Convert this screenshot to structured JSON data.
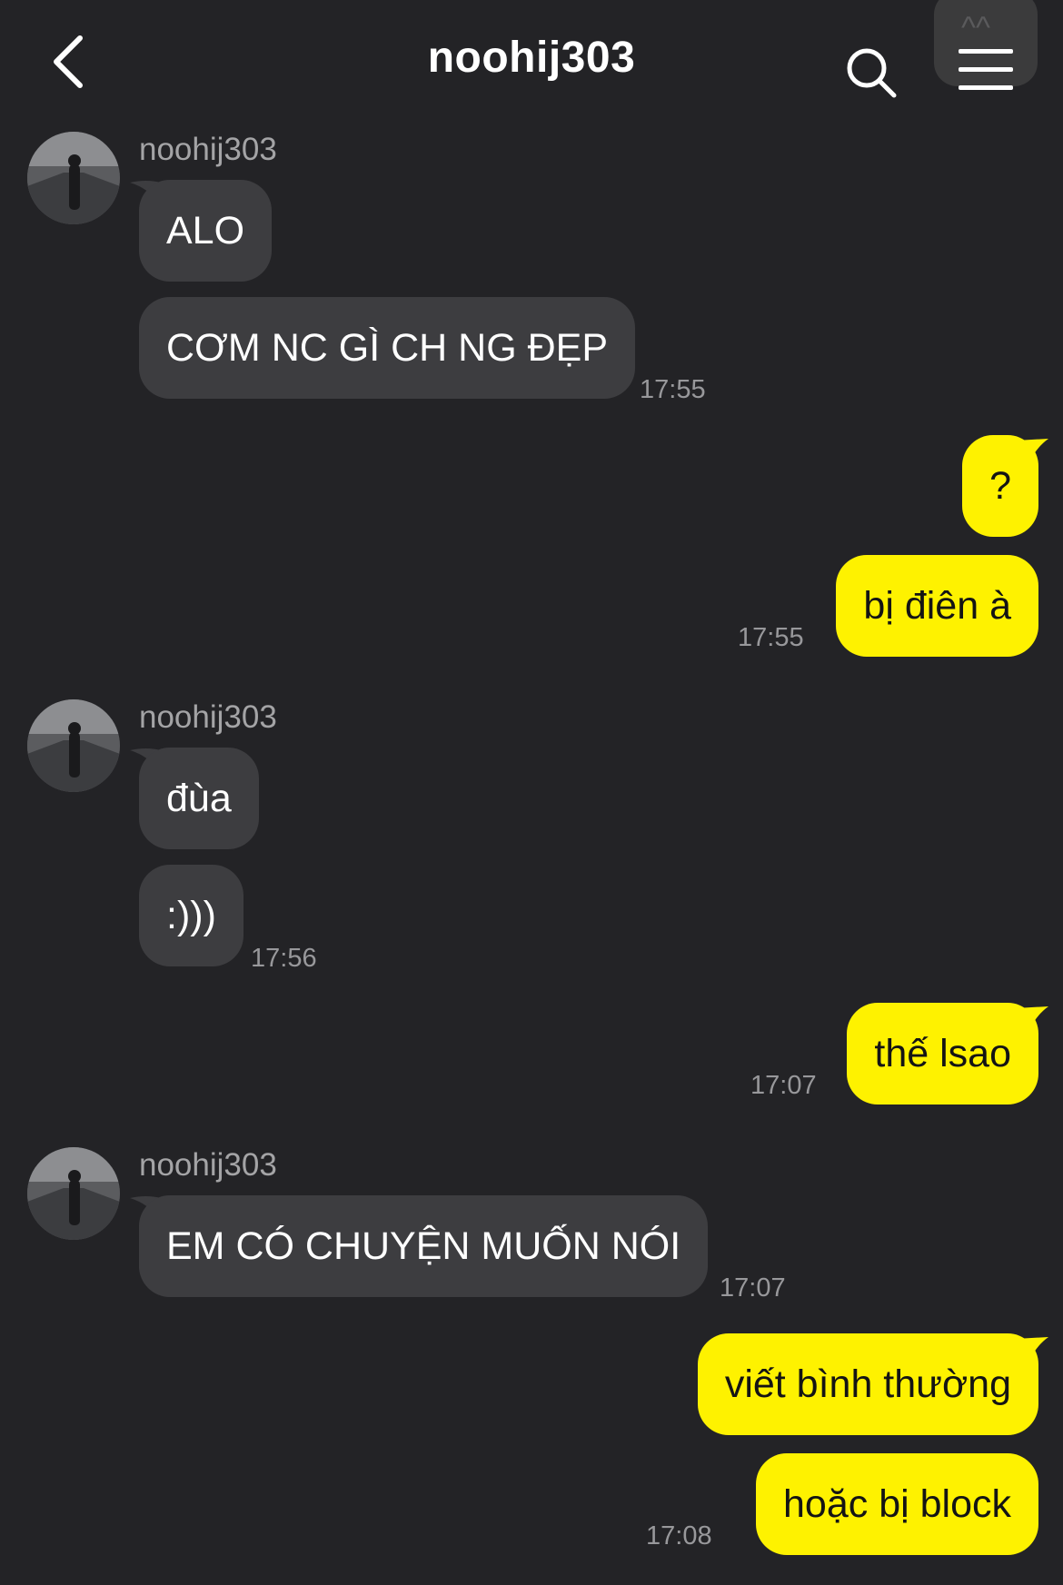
{
  "header": {
    "back_icon": "chevron-left-icon",
    "title": "noohij303",
    "search_icon": "search-icon",
    "menu_icon": "hamburger-menu-icon",
    "corner_text": "^^"
  },
  "colors": {
    "background": "#232326",
    "incoming_bubble": "#3d3d40",
    "outgoing_bubble": "#fef200",
    "timestamp": "#98989b"
  },
  "messages": [
    {
      "sender": "noohij303",
      "text": "ALO",
      "direction": "incoming"
    },
    {
      "sender": "noohij303",
      "text": "CƠM NC GÌ CH NG ĐẸP",
      "direction": "incoming",
      "time": "17:55"
    },
    {
      "text": "?",
      "direction": "outgoing"
    },
    {
      "text": "bị điên à",
      "direction": "outgoing",
      "time": "17:55"
    },
    {
      "sender": "noohij303",
      "text": "đùa",
      "direction": "incoming"
    },
    {
      "sender": "noohij303",
      "text": ":)))",
      "direction": "incoming",
      "time": "17:56"
    },
    {
      "text": "thế lsao",
      "direction": "outgoing",
      "time": "17:07"
    },
    {
      "sender": "noohij303",
      "text": "EM CÓ CHUYỆN MUỐN NÓI",
      "direction": "incoming",
      "time": "17:07"
    },
    {
      "text": "viết bình thường",
      "direction": "outgoing"
    },
    {
      "text": "hoặc bị block",
      "direction": "outgoing",
      "time": "17:08"
    }
  ]
}
